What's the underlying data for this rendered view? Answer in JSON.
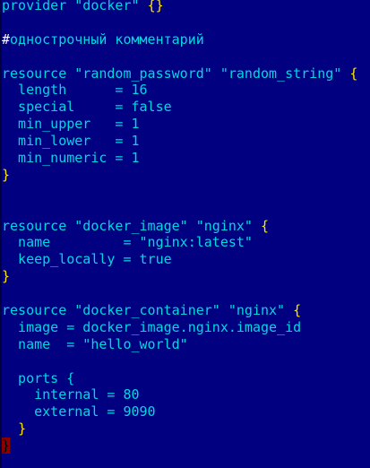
{
  "colors": {
    "background": "#000080",
    "text": "#00d8e0",
    "brace": "#ffe600",
    "comment_hash": "#ffffff",
    "match_highlight": "#8a0000"
  },
  "lines": [
    [
      {
        "t": "provider \"docker\" "
      },
      {
        "t": "{}",
        "c": "y"
      }
    ],
    [],
    [
      {
        "t": "#",
        "c": "w"
      },
      {
        "t": "однострочный комментарий"
      }
    ],
    [],
    [
      {
        "t": "resource \"random_password\" \"random_string\" "
      },
      {
        "t": "{",
        "c": "y"
      }
    ],
    [
      {
        "t": "  length      = 16"
      }
    ],
    [
      {
        "t": "  special     = false"
      }
    ],
    [
      {
        "t": "  min_upper   = 1"
      }
    ],
    [
      {
        "t": "  min_lower   = 1"
      }
    ],
    [
      {
        "t": "  min_numeric = 1"
      }
    ],
    [
      {
        "t": "}",
        "c": "y"
      }
    ],
    [],
    [],
    [
      {
        "t": "resource \"docker_image\" \"nginx\" "
      },
      {
        "t": "{",
        "c": "y"
      }
    ],
    [
      {
        "t": "  name         = \"nginx:latest\""
      }
    ],
    [
      {
        "t": "  keep_locally = true"
      }
    ],
    [
      {
        "t": "}",
        "c": "y"
      }
    ],
    [],
    [
      {
        "t": "resource \"docker_container\" \"nginx\" "
      },
      {
        "t": "{",
        "c": "y"
      }
    ],
    [
      {
        "t": "  image = docker_image.nginx.image_id"
      }
    ],
    [
      {
        "t": "  name  = \"hello_world\""
      }
    ],
    [],
    [
      {
        "t": "  ports {"
      }
    ],
    [
      {
        "t": "    internal = 80"
      }
    ],
    [
      {
        "t": "    external = 9090"
      }
    ],
    [
      {
        "t": "  "
      },
      {
        "t": "}",
        "c": "y"
      }
    ],
    [
      {
        "t": "}",
        "c": "m"
      }
    ]
  ]
}
